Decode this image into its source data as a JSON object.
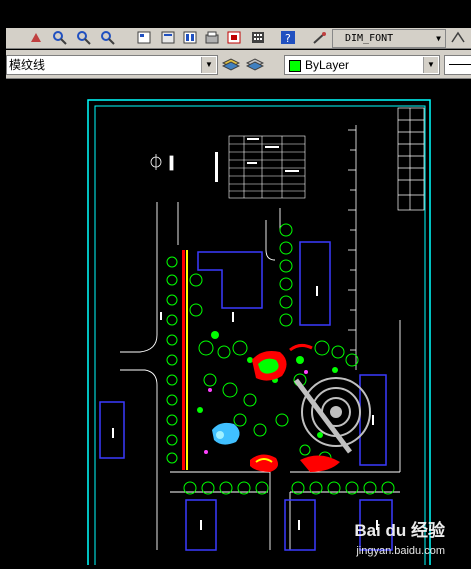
{
  "toolbar": {
    "font_name": "DIM_FONT",
    "icons": [
      "pan-icon",
      "zoom-realtime-icon",
      "zoom-window-icon",
      "zoom-previous-icon",
      "properties-icon",
      "design-center-icon",
      "tool-palette-icon",
      "sheet-set-icon",
      "markup-icon",
      "quick-calc-icon",
      "help-icon",
      "text-style-icon"
    ]
  },
  "layer_bar": {
    "linetype_value": "模纹线",
    "layer_label": "ByLayer",
    "layer_color": "#00ff00"
  },
  "drawing": {
    "frame_color": "#00ffff",
    "building_color": "#3a3aff",
    "vegetation_color": "#00ff00",
    "accent_red": "#ff0000",
    "accent_yellow": "#ffff00"
  },
  "watermark": {
    "brand": "Bai du 经验",
    "url": "jingyan.baidu.com"
  }
}
